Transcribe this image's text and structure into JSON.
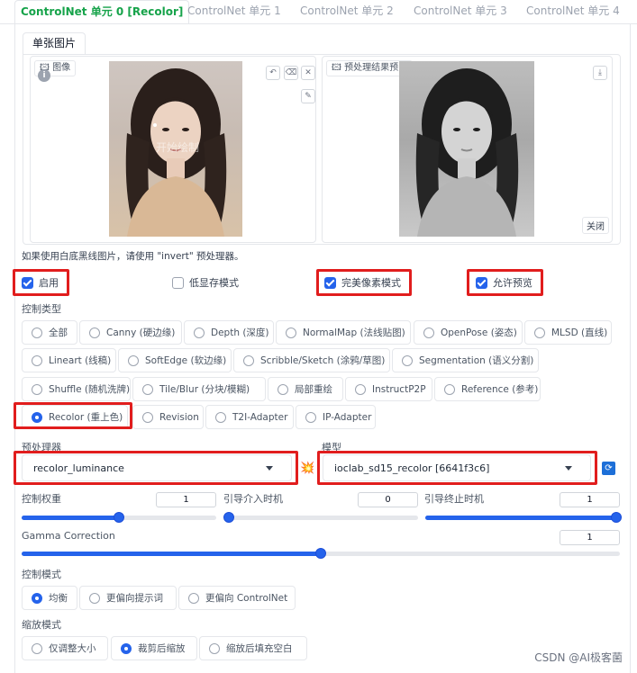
{
  "tabs": [
    "ControlNet 单元 0 [Recolor]",
    "ControlNet 单元 1",
    "ControlNet 单元 2",
    "ControlNet 单元 3",
    "ControlNet 单元 4"
  ],
  "image_tab": "单张图片",
  "image_label": "图像",
  "preview_label": "预处理结果预览",
  "close_label": "关闭",
  "note": "如果使用白底黑线图片，请使用 \"invert\" 预处理器。",
  "checkboxes": {
    "enable": "启用",
    "low_vram": "低显存模式",
    "pixel_perfect": "完美像素模式",
    "allow_preview": "允许预览"
  },
  "control_type_label": "控制类型",
  "control_types": [
    "全部",
    "Canny (硬边缘)",
    "Depth (深度)",
    "NormalMap (法线贴图)",
    "OpenPose (姿态)",
    "MLSD (直线)",
    "Lineart (线稿)",
    "SoftEdge (软边缘)",
    "Scribble/Sketch (涂鸦/草图)",
    "Segmentation (语义分割)",
    "Shuffle (随机洗牌)",
    "Tile/Blur (分块/模糊)",
    "局部重绘",
    "InstructP2P",
    "Reference (参考)",
    "Recolor (重上色)",
    "Revision",
    "T2I-Adapter",
    "IP-Adapter"
  ],
  "preprocessor_label": "预处理器",
  "preprocessor_value": "recolor_luminance",
  "model_label": "模型",
  "model_value": "ioclab_sd15_recolor [6641f3c6]",
  "sliders": {
    "weight": {
      "label": "控制权重",
      "value": "1",
      "fraction": 0.5
    },
    "start": {
      "label": "引导介入时机",
      "value": "0",
      "fraction": 0.0
    },
    "end": {
      "label": "引导终止时机",
      "value": "1",
      "fraction": 1.0
    },
    "gamma": {
      "label": "Gamma Correction",
      "value": "1",
      "fraction": 0.5
    }
  },
  "control_mode_label": "控制模式",
  "control_modes": [
    "均衡",
    "更偏向提示词",
    "更偏向 ControlNet"
  ],
  "resize_mode_label": "缩放模式",
  "resize_modes": [
    "仅调整大小",
    "裁剪后缩放",
    "缩放后填充空白"
  ],
  "overlay_text": "开始绘制",
  "watermark": "CSDN @AI极客菌",
  "colors": {
    "accent": "#2563eb",
    "active_tab": "#16a34a",
    "highlight": "#e11d1d"
  }
}
